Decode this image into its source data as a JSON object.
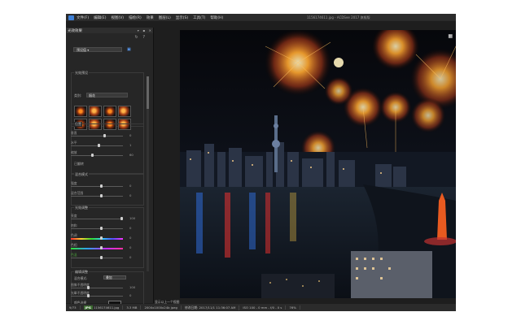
{
  "app": {
    "menu": [
      "文件(F)",
      "编辑(E)",
      "视图(V)",
      "描绘(R)",
      "效果",
      "图层(L)",
      "显示(S)",
      "工具(T)",
      "帮助(H)"
    ],
    "window_title": "1156174611.jpg - ACDSee 2017 旗舰版"
  },
  "panel": {
    "title": "光效效果",
    "preset_label": "预设值",
    "section_light": "光效预设",
    "category_label": "类别:",
    "category_value": "烟花",
    "section_position": "位置",
    "position_rows": [
      {
        "label": "垂直",
        "value": "0"
      },
      {
        "label": "水平",
        "value": "1"
      },
      {
        "label": "缩放",
        "value": "60"
      }
    ],
    "reset_label": "已翻转",
    "section_blend": "混合模式",
    "blend_rows": [
      {
        "label": "强度",
        "value": "0"
      },
      {
        "label": "混合范围",
        "value": "0"
      }
    ],
    "section_color": "光效调整",
    "color_rows": [
      {
        "label": "亮度",
        "value": "100"
      },
      {
        "label": "饱和",
        "value": "0"
      },
      {
        "label": "色调",
        "value": "0"
      },
      {
        "label": "色相",
        "value": "0"
      },
      {
        "label": "色温",
        "value": "0"
      }
    ],
    "section_edit": "编辑调整",
    "blend_mode_label": "混合模式:",
    "blend_mode_value": "叠加",
    "edit_rows": [
      {
        "label": "图像不透明度",
        "value": "100"
      },
      {
        "label": "光晕不透明度",
        "value": "0"
      }
    ],
    "color_label": "颜色选择",
    "btn_ok": "完成",
    "btn_cancel": "取消"
  },
  "viewer": {
    "zoom_hint": "显示以上一个视图"
  },
  "status": {
    "index": "9/73",
    "badge": "JPG",
    "filename": "1156174611.jpg",
    "filesize": "3.3 MB",
    "dimensions": "2000x1000x24b jpeg",
    "modified": "修改日期: 2017/11/1 11:36:07 AM",
    "exif": "ISO 100 - 0 mm - f/0 - 0 s",
    "zoom": "76%"
  }
}
